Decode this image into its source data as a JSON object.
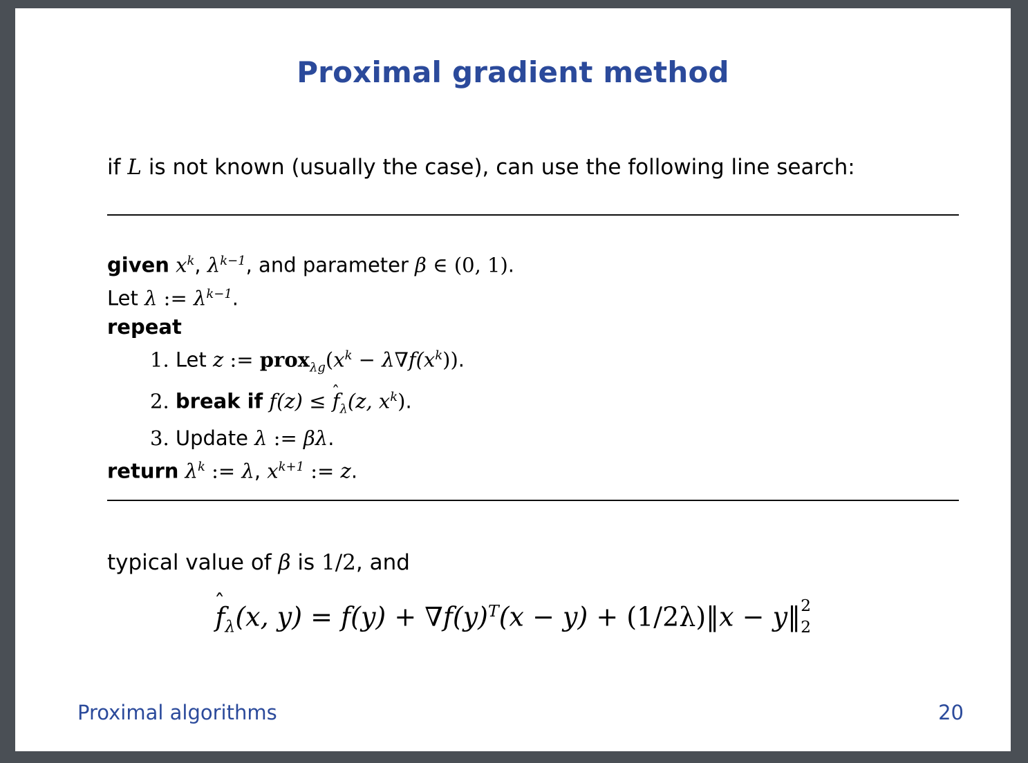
{
  "document": {
    "type": "lecture-slide",
    "title": "Proximal gradient method",
    "page_number": "20",
    "footer_label": "Proximal algorithms",
    "title_color": "#2b4a9b",
    "background_color": "#4a4f55",
    "slide_color": "#ffffff"
  },
  "intro": {
    "prefix": "if ",
    "symbol": "L",
    "suffix": " is not known (usually the case), can use the following line search:"
  },
  "algorithm": {
    "given": {
      "keyword": "given",
      "var_x": "x",
      "var_x_sup": "k",
      "comma1": ", ",
      "lambda": "λ",
      "lambda_sup": "k−1",
      "mid": ", and parameter ",
      "beta": "β",
      "in": " ∈ ",
      "interval": "(0, 1)",
      "period": "."
    },
    "let": {
      "text": "Let ",
      "lambda": "λ",
      "assign": " := ",
      "lambda2": "λ",
      "lambda2_sup": "k−1",
      "period": "."
    },
    "repeat_keyword": "repeat",
    "steps": [
      {
        "number": "1.",
        "lead": "Let ",
        "z": "z",
        "assign": " := ",
        "prox": "prox",
        "prox_sub": "λg",
        "open": "(",
        "x": "x",
        "x_sup": "k",
        "minus": " − ",
        "lambda": "λ",
        "grad": "∇",
        "f": "f",
        "inner": "(x",
        "inner_sup": "k",
        "close": "))",
        "period": "."
      },
      {
        "number": "2.",
        "keyword": "break if",
        "lhs_f": "f",
        "lhs_arg": "(z)",
        "le": " ≤ ",
        "hat_f": "f",
        "hat": "ˆ",
        "sub_lambda": "λ",
        "rhs_open": "(z, x",
        "rhs_sup": "k",
        "rhs_close": ")",
        "period": "."
      },
      {
        "number": "3.",
        "lead": "Update ",
        "lambda": "λ",
        "assign": " := ",
        "beta": "β",
        "lambda2": "λ",
        "period": "."
      }
    ],
    "return": {
      "keyword": "return",
      "lambda": "λ",
      "lambda_sup": "k",
      "assign1": " := ",
      "lambda2": "λ",
      "comma": ", ",
      "x": "x",
      "x_sup": "k+1",
      "assign2": " := ",
      "z": "z",
      "period": "."
    }
  },
  "typical": {
    "prefix": "typical value of ",
    "beta": "β",
    "mid": " is ",
    "value": "1/2",
    "suffix": ", and"
  },
  "equation": {
    "hat": "ˆ",
    "f": "f",
    "sub_lambda": "λ",
    "args": "(x, y)",
    "eq": " = ",
    "f2": "f",
    "f2_args": "(y)",
    "plus1": " + ",
    "grad": "∇",
    "f3": "f",
    "f3_args": "(y)",
    "transpose": "T",
    "diff1": "(x − y)",
    "plus2": " + ",
    "coef": "(1/2λ)",
    "norm_open": "‖",
    "diff2": "x − y",
    "norm_close": "‖",
    "norm_sup": "2",
    "norm_sub": "2",
    "plain_text": "f̂λ(x, y) = f(y) + ∇f(y)^T(x − y) + (1/2λ)‖x − y‖²₂"
  }
}
